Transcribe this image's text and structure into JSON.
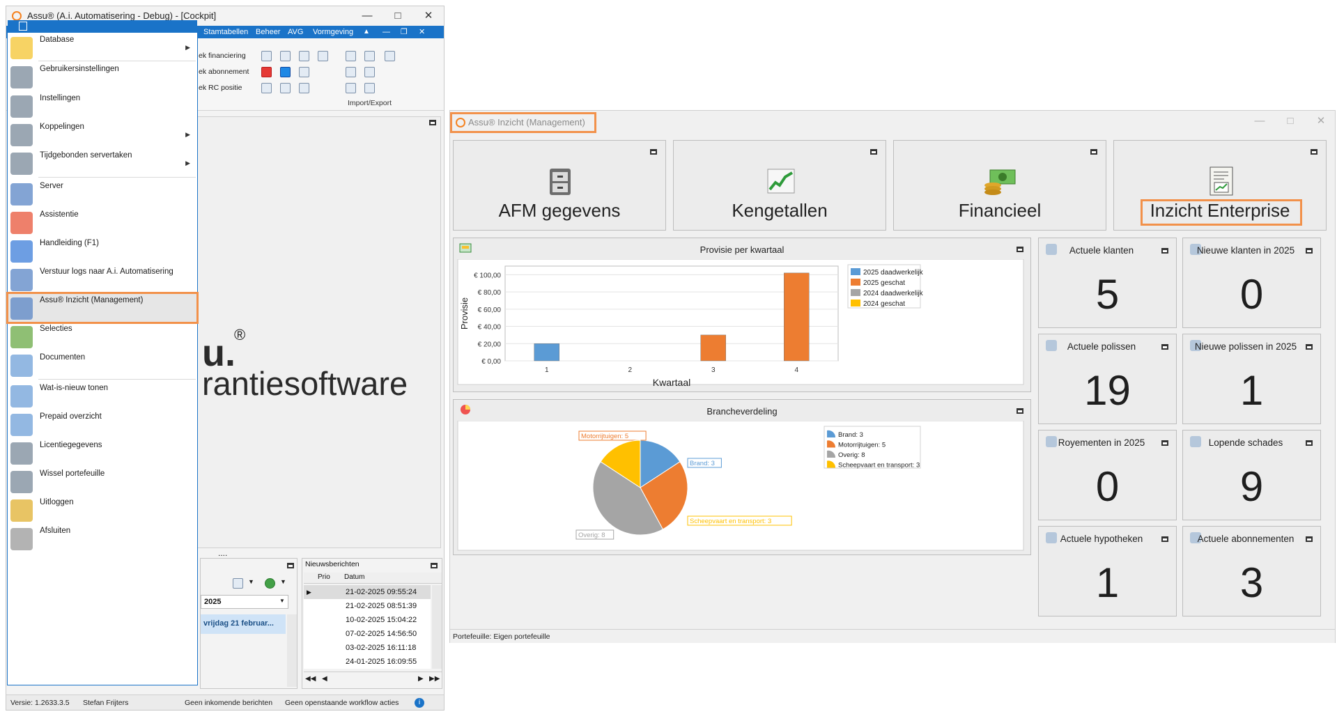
{
  "cockpit": {
    "title": "Assu® (A.i. Automatisering - Debug) - [Cockpit]",
    "menubar": [
      "Stamtabellen",
      "Beheer",
      "AVG",
      "Vormgeving"
    ],
    "ribbon_items": [
      "ek financiering",
      "ek abonnement",
      "ek RC positie"
    ],
    "ribbon_group_label": "Import/Export",
    "logo_text": "u.",
    "logo_mark": "®",
    "tagline": "rantiesoftware",
    "ellipsis": "....",
    "date_selector": "2025",
    "selected_day": "vrijdag 21 februar...",
    "news": {
      "title": "Nieuwsberichten",
      "columns": [
        "Prio",
        "Datum"
      ],
      "rows": [
        "21-02-2025 09:55:24",
        "21-02-2025 08:51:39",
        "10-02-2025 15:04:22",
        "07-02-2025 14:56:50",
        "03-02-2025 16:11:18",
        "24-01-2025 16:09:55"
      ]
    },
    "status": {
      "version": "Versie: 1.2633.3.5",
      "user": "Stefan Frijters",
      "messages": "Geen inkomende berichten",
      "workflow": "Geen openstaande workflow acties"
    }
  },
  "app_menu": {
    "items": [
      {
        "label": "Database",
        "icon": "database-icon",
        "submenu": true
      },
      {
        "label": "Gebruikersinstellingen",
        "icon": "user-settings-icon",
        "submenu": false
      },
      {
        "label": "Instellingen",
        "icon": "settings-icon",
        "submenu": false
      },
      {
        "label": "Koppelingen",
        "icon": "link-settings-icon",
        "submenu": true
      },
      {
        "label": "Tijdgebonden servertaken",
        "icon": "calendar-icon",
        "submenu": true
      },
      {
        "label": "Server",
        "icon": "server-icon",
        "submenu": false
      },
      {
        "label": "Assistentie",
        "icon": "lifebuoy-icon",
        "submenu": false
      },
      {
        "label": "Handleiding (F1)",
        "icon": "help-icon",
        "submenu": false
      },
      {
        "label": "Verstuur logs naar A.i. Automatisering",
        "icon": "send-logs-icon",
        "submenu": false
      },
      {
        "label": "Assu® Inzicht (Management)",
        "icon": "insight-icon",
        "submenu": false
      },
      {
        "label": "Selecties",
        "icon": "selection-icon",
        "submenu": false
      },
      {
        "label": "Documenten",
        "icon": "documents-icon",
        "submenu": false
      },
      {
        "label": "Wat-is-nieuw tonen",
        "icon": "whats-new-icon",
        "submenu": false
      },
      {
        "label": "Prepaid overzicht",
        "icon": "prepaid-icon",
        "submenu": false
      },
      {
        "label": "Licentiegegevens",
        "icon": "license-icon",
        "submenu": false
      },
      {
        "label": "Wissel portefeuille",
        "icon": "switch-portfolio-icon",
        "submenu": false
      },
      {
        "label": "Uitloggen",
        "icon": "key-icon",
        "submenu": false
      },
      {
        "label": "Afsluiten",
        "icon": "exit-icon",
        "submenu": false
      }
    ],
    "highlighted": "Assu® Inzicht (Management)"
  },
  "inzicht": {
    "title": "Assu® Inzicht (Management)",
    "tiles": [
      {
        "label": "AFM gegevens",
        "icon": "cabinet-icon"
      },
      {
        "label": "Kengetallen",
        "icon": "trend-chart-icon"
      },
      {
        "label": "Financieel",
        "icon": "money-icon"
      },
      {
        "label": "Inzicht Enterprise",
        "icon": "report-icon"
      }
    ],
    "kpis": [
      {
        "title": "Actuele klanten",
        "value": "5",
        "icon": "person-icon"
      },
      {
        "title": "Nieuwe klanten in 2025",
        "value": "0",
        "icon": "new-person-icon"
      },
      {
        "title": "Actuele polissen",
        "value": "19",
        "icon": "policy-icon"
      },
      {
        "title": "Nieuwe polissen in 2025",
        "value": "1",
        "icon": "new-policy-icon"
      },
      {
        "title": "Royementen in 2025",
        "value": "0",
        "icon": "cancel-policy-icon"
      },
      {
        "title": "Lopende schades",
        "value": "9",
        "icon": "lightning-icon"
      },
      {
        "title": "Actuele hypotheken",
        "value": "1",
        "icon": "house-icon"
      },
      {
        "title": "Actuele abonnementen",
        "value": "3",
        "icon": "subscription-icon"
      }
    ],
    "status": "Portefeuille: Eigen portefeuille",
    "colors": {
      "blue": "#5b9bd5",
      "orange": "#ed7d31",
      "gray": "#a5a5a5",
      "yellow": "#ffc000",
      "highlight": "#f2914a"
    }
  },
  "chart_data": [
    {
      "type": "bar",
      "title": "Provisie per kwartaal",
      "xlabel": "Kwartaal",
      "ylabel": "Provisie",
      "categories": [
        "1",
        "2",
        "3",
        "4"
      ],
      "yticks": [
        "€ 0,00",
        "€ 20,00",
        "€ 40,00",
        "€ 60,00",
        "€ 80,00",
        "€ 100,00"
      ],
      "ylim": [
        0,
        110
      ],
      "grid": true,
      "legend": "right",
      "series": [
        {
          "name": "2025 daadwerkelijk",
          "color": "#5b9bd5",
          "values": [
            20,
            0,
            0,
            0
          ]
        },
        {
          "name": "2025 geschat",
          "color": "#ed7d31",
          "values": [
            0,
            0,
            30,
            102
          ]
        },
        {
          "name": "2024 daadwerkelijk",
          "color": "#a5a5a5",
          "values": [
            0,
            0,
            0,
            0
          ]
        },
        {
          "name": "2024 geschat",
          "color": "#ffc000",
          "values": [
            0,
            0,
            0,
            0
          ]
        }
      ]
    },
    {
      "type": "pie",
      "title": "Brancheverdeling",
      "legend": "right",
      "slices": [
        {
          "label": "Brand: 3",
          "name": "Brand",
          "value": 3,
          "color": "#5b9bd5"
        },
        {
          "label": "Motorrijtuigen: 5",
          "name": "Motorrijtuigen",
          "value": 5,
          "color": "#ed7d31"
        },
        {
          "label": "Overig: 8",
          "name": "Overig",
          "value": 8,
          "color": "#a5a5a5"
        },
        {
          "label": "Scheepvaart en transport: 3",
          "name": "Scheepvaart en transport",
          "value": 3,
          "color": "#ffc000"
        }
      ]
    }
  ]
}
